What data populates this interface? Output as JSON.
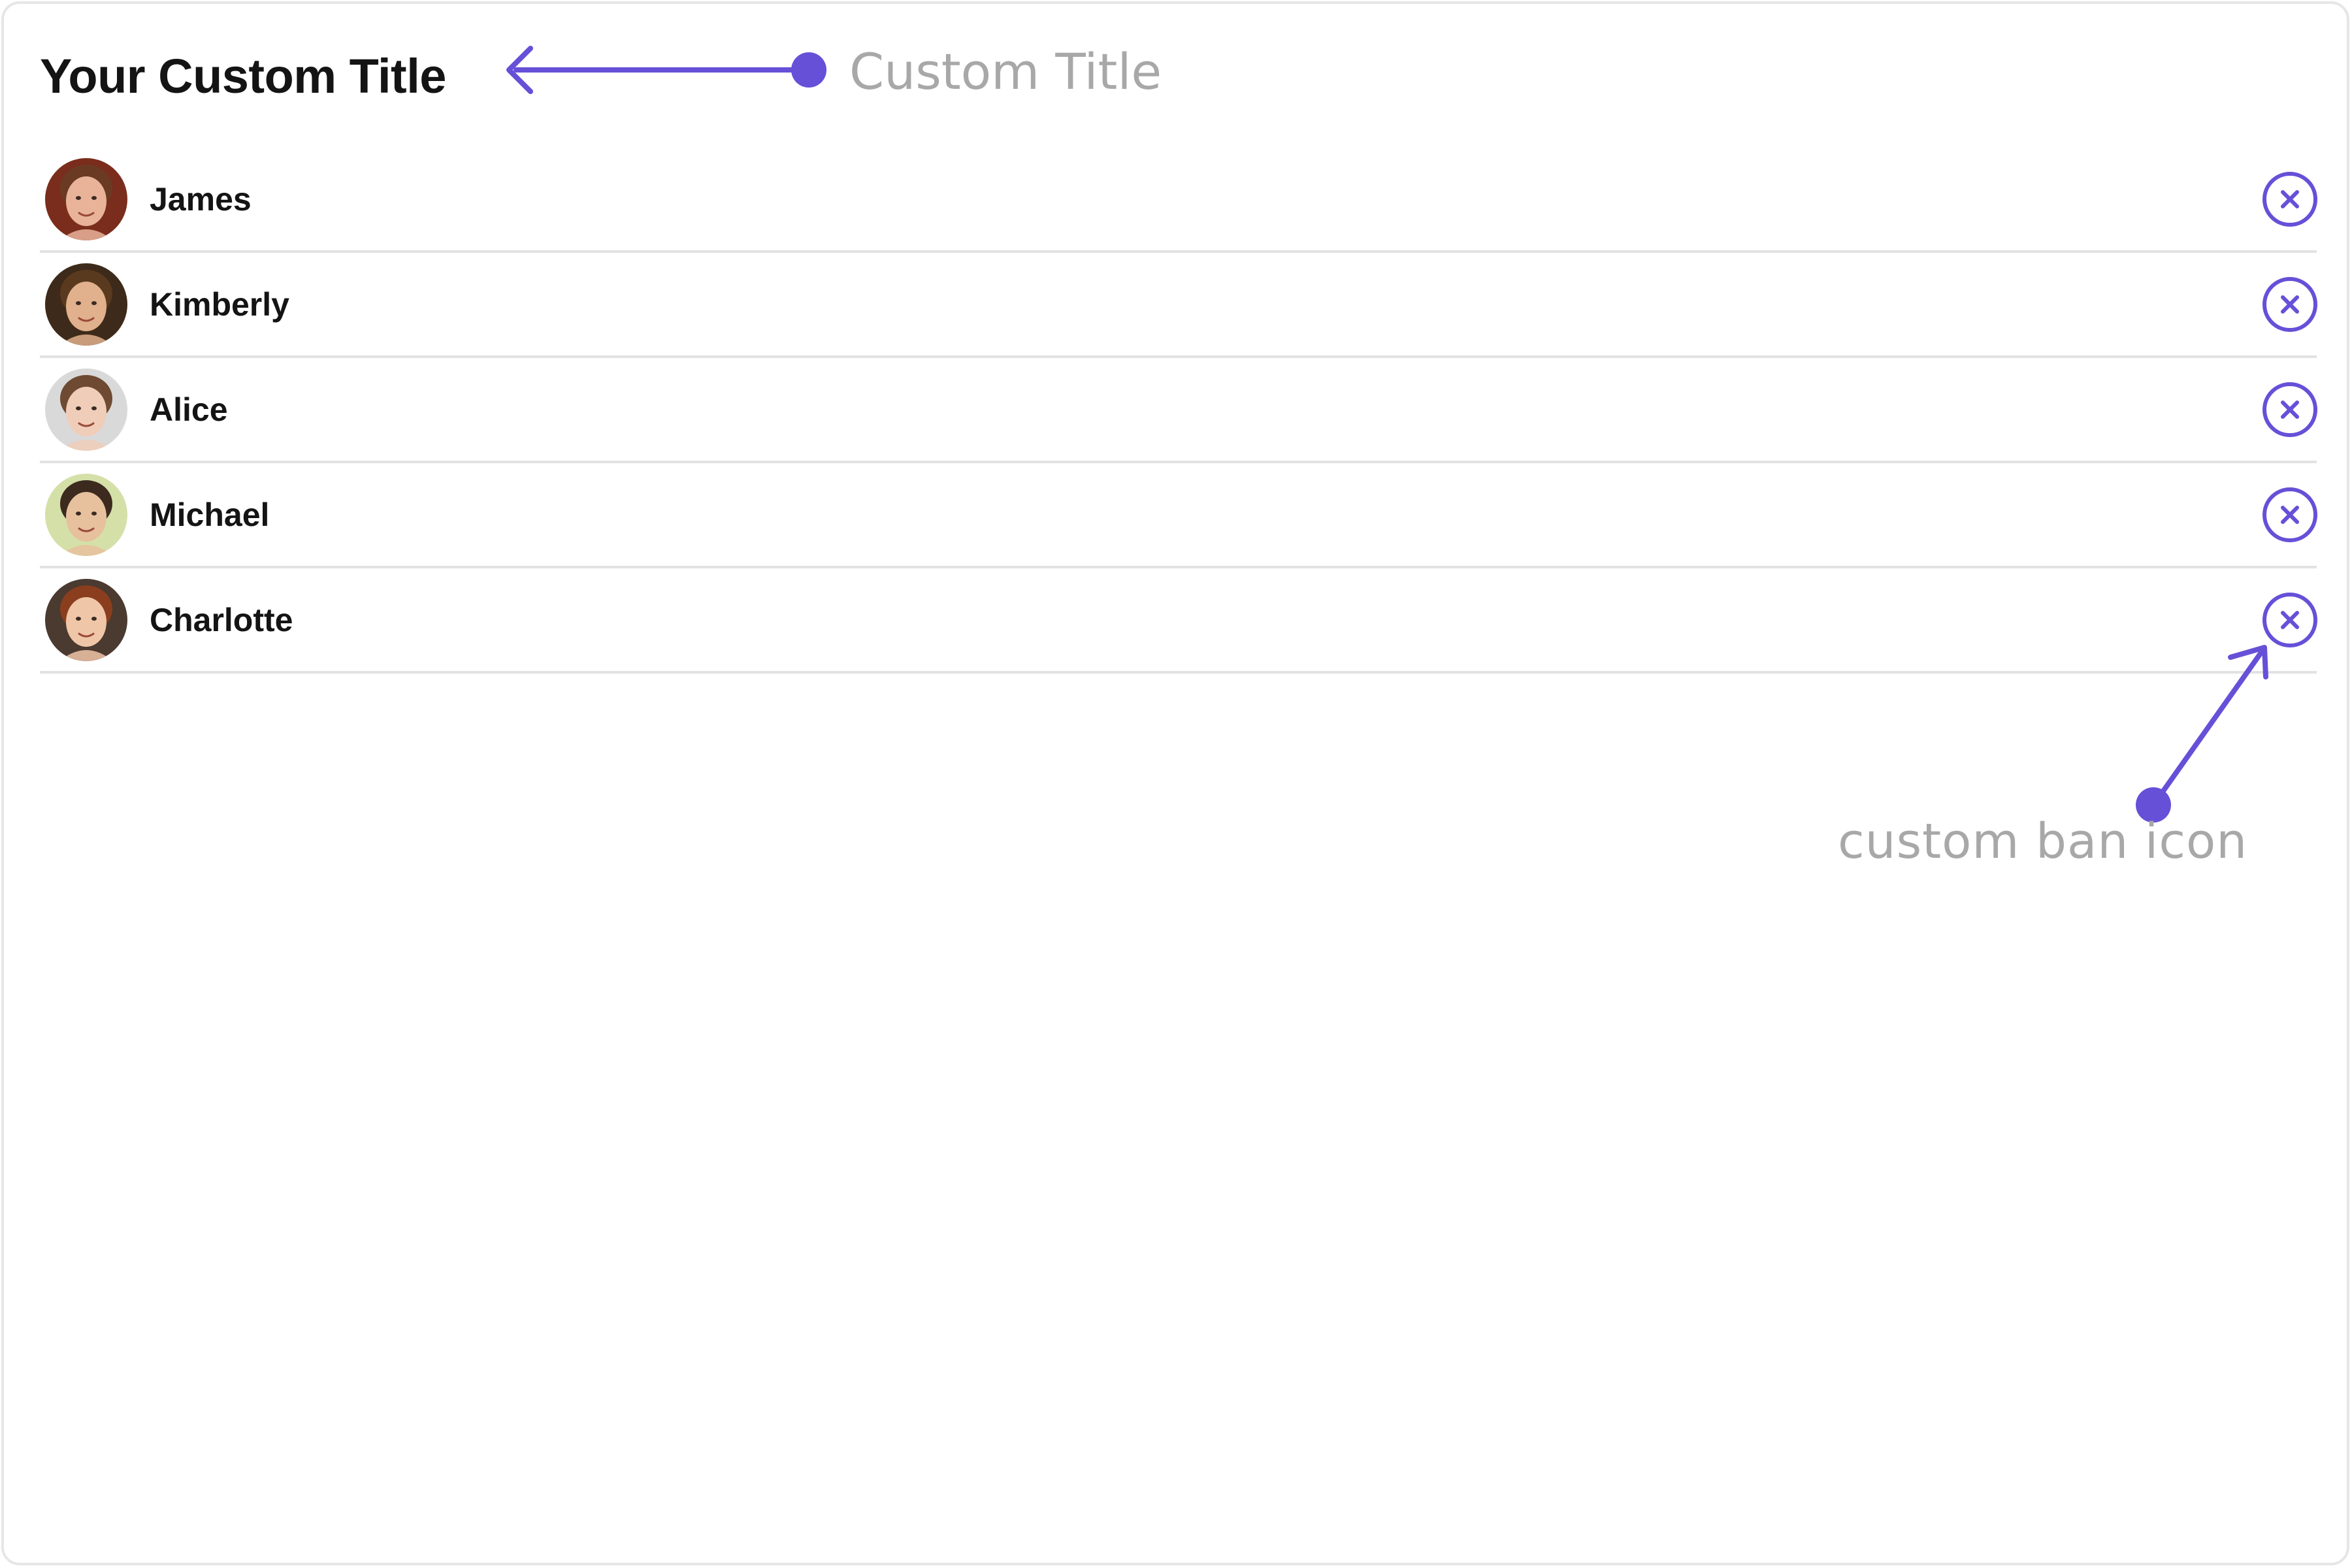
{
  "header": {
    "title": "Your Custom Title"
  },
  "annotations": {
    "title_label": "Custom Title",
    "ban_icon_label": "custom ban icon"
  },
  "members": [
    {
      "name": "James",
      "avatar": "avatar-james",
      "skin": "#e9b39a",
      "hair": "#6b3a22",
      "bg": "#7a2d1c"
    },
    {
      "name": "Kimberly",
      "avatar": "avatar-kimberly",
      "skin": "#e1b08c",
      "hair": "#5a3a1e",
      "bg": "#3d2a1a"
    },
    {
      "name": "Alice",
      "avatar": "avatar-alice",
      "skin": "#f0cdb8",
      "hair": "#6e4a32",
      "bg": "#d9d9d9"
    },
    {
      "name": "Michael",
      "avatar": "avatar-michael",
      "skin": "#e7c09e",
      "hair": "#3c2a1e",
      "bg": "#d4e0a8"
    },
    {
      "name": "Charlotte",
      "avatar": "avatar-charlotte",
      "skin": "#f0c6a8",
      "hair": "#8a3e1e",
      "bg": "#4a3a30"
    }
  ],
  "icons": {
    "ban": "ban-icon"
  },
  "colors": {
    "accent": "#6650d8",
    "title": "#141414",
    "annotation_text": "#a8a8a8",
    "divider": "#e2e2e2"
  }
}
